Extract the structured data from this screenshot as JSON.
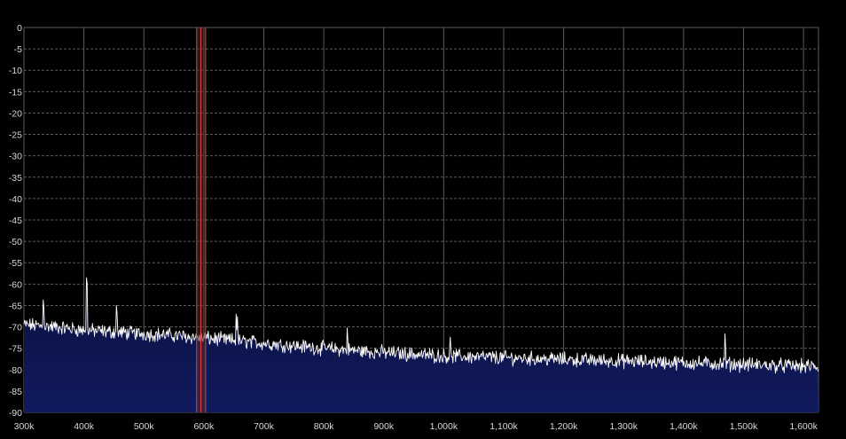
{
  "chart_data": {
    "type": "area",
    "title": "",
    "xlabel": "",
    "ylabel": "",
    "xlim": [
      300000,
      1625000
    ],
    "ylim": [
      -90,
      0
    ],
    "x_ticks": [
      300000,
      400000,
      500000,
      600000,
      700000,
      800000,
      900000,
      1000000,
      1100000,
      1200000,
      1300000,
      1400000,
      1500000,
      1600000
    ],
    "x_tick_labels": [
      "300k",
      "400k",
      "500k",
      "600k",
      "700k",
      "800k",
      "900k",
      "1,000k",
      "1,100k",
      "1,200k",
      "1,300k",
      "1,400k",
      "1,500k",
      "1,600k"
    ],
    "y_ticks": [
      0,
      -5,
      -10,
      -15,
      -20,
      -25,
      -30,
      -35,
      -40,
      -45,
      -50,
      -55,
      -60,
      -65,
      -70,
      -75,
      -80,
      -85,
      -90
    ],
    "y_tick_labels": [
      "0",
      "-5",
      "-10",
      "-15",
      "-20",
      "-25",
      "-30",
      "-35",
      "-40",
      "-45",
      "-50",
      "-55",
      "-60",
      "-65",
      "-70",
      "-75",
      "-80",
      "-85",
      "-90"
    ],
    "grid": true,
    "legend": "none",
    "noise_floor": {
      "x": [
        300000,
        350000,
        400000,
        450000,
        500000,
        550000,
        600000,
        650000,
        700000,
        750000,
        800000,
        850000,
        900000,
        950000,
        1000000,
        1050000,
        1100000,
        1150000,
        1200000,
        1250000,
        1300000,
        1350000,
        1400000,
        1450000,
        1500000,
        1550000,
        1600000,
        1625000
      ],
      "y": [
        -69.5,
        -70,
        -70.8,
        -71.2,
        -71.6,
        -72,
        -72.6,
        -73.2,
        -73.8,
        -74.4,
        -75,
        -75.5,
        -76,
        -76.4,
        -76.8,
        -77,
        -77.2,
        -77.4,
        -77.6,
        -77.8,
        -78,
        -78.2,
        -78.4,
        -78.6,
        -78.8,
        -79,
        -79.2,
        -79.3
      ]
    },
    "peaks": [
      {
        "x": 333000,
        "y": -66.5
      },
      {
        "x": 405000,
        "y": -61
      },
      {
        "x": 455000,
        "y": -67.8
      },
      {
        "x": 655000,
        "y": -71
      },
      {
        "x": 840000,
        "y": -73.5
      },
      {
        "x": 1010000,
        "y": -75.5
      },
      {
        "x": 1320000,
        "y": -81.5
      },
      {
        "x": 1470000,
        "y": -75
      }
    ],
    "marker_band": {
      "x_start": 588000,
      "x_end": 603000,
      "center": 595000
    },
    "colors": {
      "background": "#000000",
      "grid": "#5a5a5a",
      "trace": "#ffffff",
      "fill_top": "#0b1140",
      "fill_bottom": "#111a5e",
      "band": "#6a2424",
      "band_line": "#e04848",
      "tick_text": "#d8d8d8"
    }
  }
}
